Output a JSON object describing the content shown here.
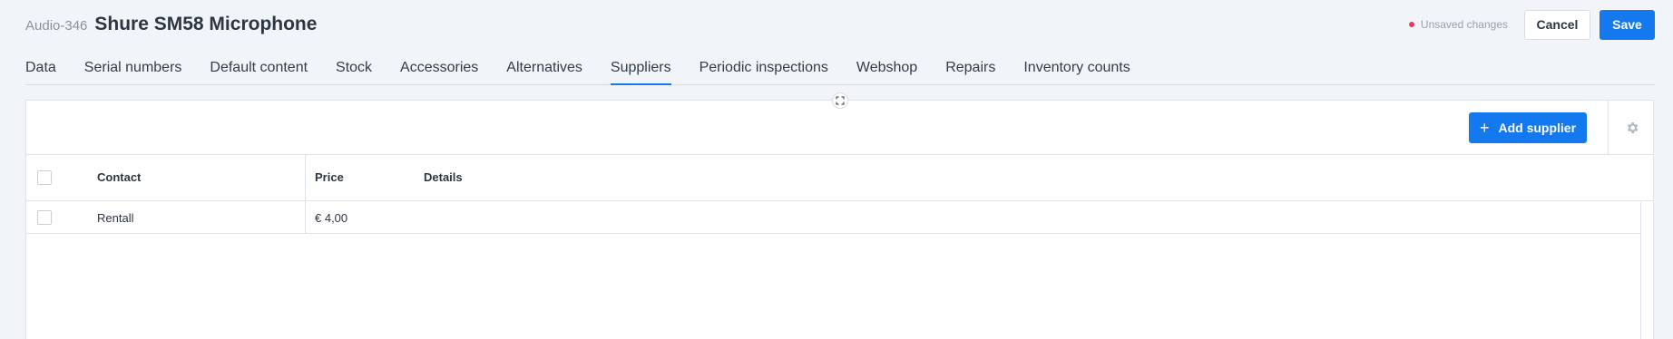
{
  "header": {
    "item_code": "Audio-346",
    "item_title": "Shure SM58 Microphone",
    "unsaved_label": "Unsaved changes",
    "cancel_label": "Cancel",
    "save_label": "Save"
  },
  "tabs": [
    {
      "label": "Data"
    },
    {
      "label": "Serial numbers"
    },
    {
      "label": "Default content"
    },
    {
      "label": "Stock"
    },
    {
      "label": "Accessories"
    },
    {
      "label": "Alternatives"
    },
    {
      "label": "Suppliers",
      "active": true
    },
    {
      "label": "Periodic inspections"
    },
    {
      "label": "Webshop"
    },
    {
      "label": "Repairs"
    },
    {
      "label": "Inventory counts"
    }
  ],
  "toolbar": {
    "add_label": "Add supplier",
    "add_icon": "plus-icon",
    "settings_icon": "gear-icon",
    "expand_icon": "expand-icon"
  },
  "table": {
    "columns": [
      "Contact",
      "Price",
      "Details"
    ],
    "rows": [
      {
        "contact": "Rentall",
        "price": "€ 4,00",
        "details": ""
      }
    ]
  },
  "colors": {
    "accent": "#1478ee",
    "unsaved_dot": "#e8395c",
    "background": "#f1f4f8"
  }
}
